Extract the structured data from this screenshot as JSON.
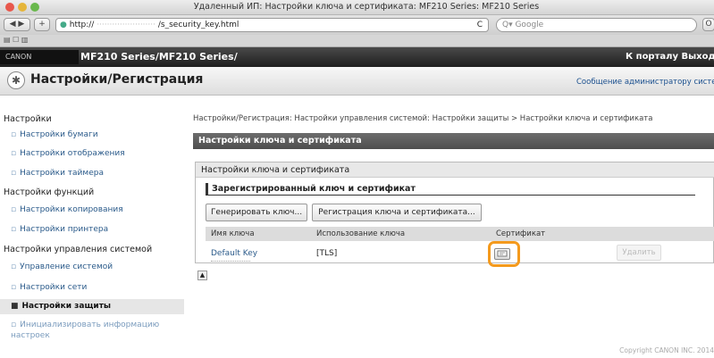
{
  "window": {
    "title": "Удаленный ИП: Настройки ключа и сертификата: MF210 Series: MF210 Series"
  },
  "toolbar": {
    "url_prefix": "http://",
    "url_path": "/s_security_key.html",
    "search_placeholder": "Q▾ Google"
  },
  "header": {
    "brand": "CANON",
    "device_title": "MF210 Series/MF210 Series/",
    "portal_link": "К порталу Выход"
  },
  "page": {
    "title": "Настройки/Регистрация",
    "admin_message": "Сообщение администратору системы"
  },
  "sidebar": {
    "groups": [
      {
        "heading": "Настройки",
        "items": [
          "Настройки бумаги",
          "Настройки отображения",
          "Настройки таймера"
        ]
      },
      {
        "heading": "Настройки функций",
        "items": [
          "Настройки копирования",
          "Настройки принтера"
        ]
      },
      {
        "heading": "Настройки управления системой",
        "items": [
          "Управление системой",
          "Настройки сети",
          "Настройки защиты",
          "Инициализировать информацию настроек"
        ]
      }
    ],
    "selected": "Настройки защиты"
  },
  "main": {
    "breadcrumb": "Настройки/Регистрация: Настройки управления системой: Настройки защиты > Настройки ключа и сертификата",
    "section_title": "Настройки ключа и сертификата",
    "panel_title": "Настройки ключа и сертификата",
    "subsection_title": "Зарегистрированный ключ и сертификат",
    "buttons": {
      "generate": "Генерировать ключ...",
      "register": "Регистрация ключа и сертификата..."
    },
    "table": {
      "headers": [
        "Имя ключа",
        "Использование ключа",
        "Сертификат",
        ""
      ],
      "rows": [
        {
          "key_name": "Default Key",
          "usage": "[TLS]",
          "delete": "Удалить"
        }
      ]
    }
  },
  "footer": {
    "copyright": "Copyright CANON INC. 2014"
  }
}
